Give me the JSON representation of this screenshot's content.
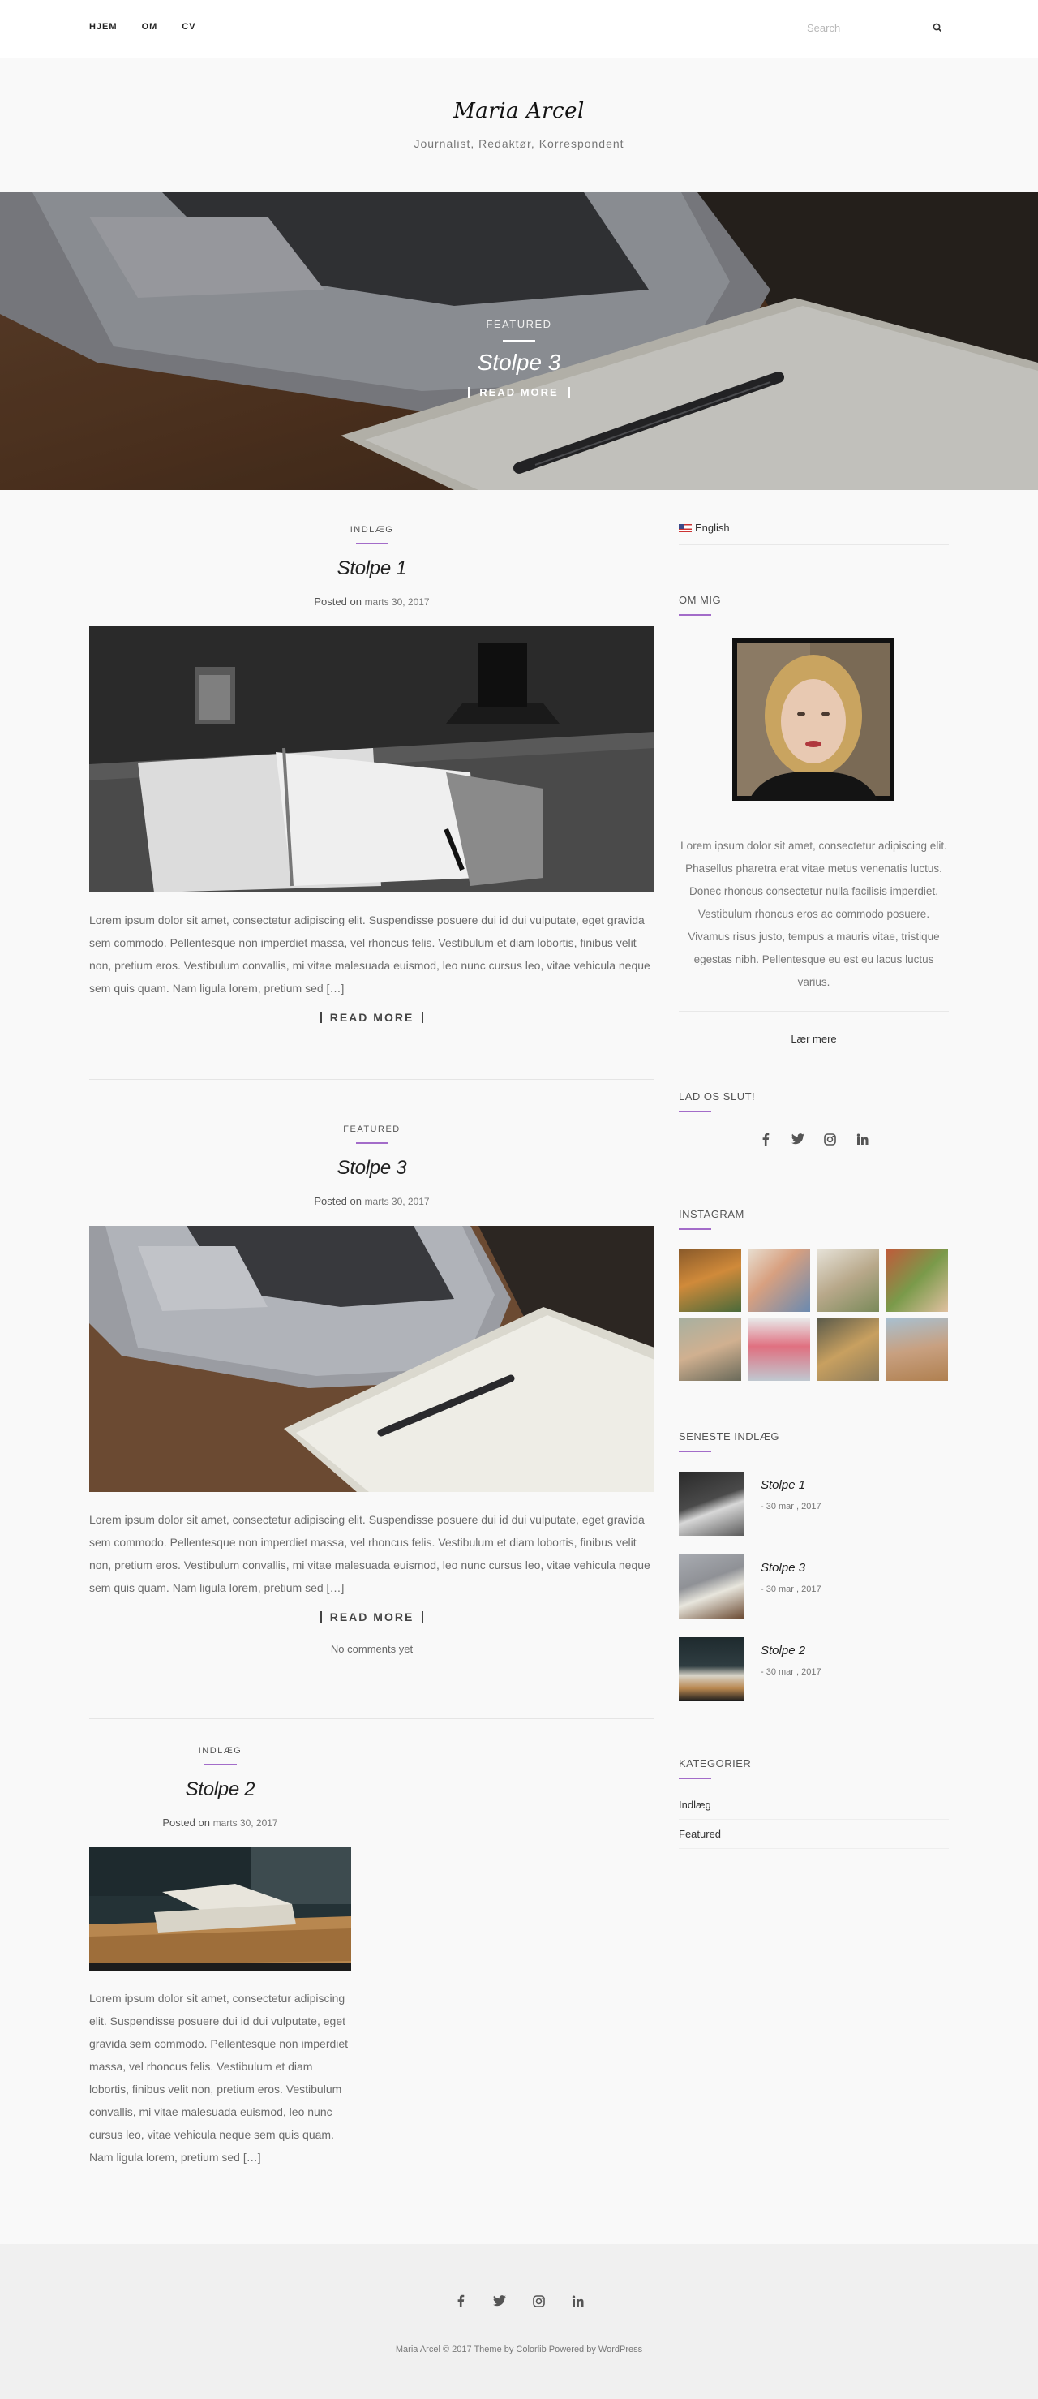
{
  "nav": {
    "items": [
      "HJEM",
      "OM",
      "CV"
    ],
    "search_placeholder": "Search"
  },
  "site": {
    "title": "Maria Arcel",
    "tagline": "Journalist, Redaktør, Korrespondent"
  },
  "hero": {
    "category": "FEATURED",
    "title": "Stolpe 3",
    "read_more": "READ MORE"
  },
  "posts": [
    {
      "category": "INDLÆG",
      "title": "Stolpe 1",
      "posted_on": "Posted on",
      "date": "marts 30, 2017",
      "excerpt": "Lorem ipsum dolor sit amet, consectetur adipiscing elit. Suspendisse posuere dui id dui vulputate, eget gravida sem commodo. Pellentesque non imperdiet massa, vel rhoncus felis. Vestibulum et diam lobortis, finibus velit non, pretium eros. Vestibulum convallis, mi vitae malesuada euismod, leo nunc cursus leo, vitae vehicula neque sem quis quam. Nam ligula lorem, pretium sed […]",
      "read_more": "READ MORE"
    },
    {
      "category": "FEATURED",
      "title": "Stolpe 3",
      "posted_on": "Posted on",
      "date": "marts 30, 2017",
      "excerpt": "Lorem ipsum dolor sit amet, consectetur adipiscing elit. Suspendisse posuere dui id dui vulputate, eget gravida sem commodo. Pellentesque non imperdiet massa, vel rhoncus felis. Vestibulum et diam lobortis, finibus velit non, pretium eros. Vestibulum convallis, mi vitae malesuada euismod, leo nunc cursus leo, vitae vehicula neque sem quis quam. Nam ligula lorem, pretium sed […]",
      "read_more": "READ MORE",
      "comments": "No comments yet"
    },
    {
      "category": "INDLÆG",
      "title": "Stolpe 2",
      "posted_on": "Posted on",
      "date": "marts 30, 2017",
      "excerpt": "Lorem ipsum dolor sit amet, consectetur adipiscing elit. Suspendisse posuere dui id dui vulputate, eget gravida sem commodo. Pellentesque non imperdiet massa, vel rhoncus felis. Vestibulum et diam lobortis, finibus velit non, pretium eros. Vestibulum convallis, mi vitae malesuada euismod, leo nunc cursus leo, vitae vehicula neque sem quis quam. Nam ligula lorem, pretium sed […]"
    }
  ],
  "sidebar": {
    "language": "English",
    "about": {
      "title": "OM MIG",
      "text": "Lorem ipsum dolor sit amet, consectetur adipiscing elit. Phasellus pharetra erat vitae metus venenatis luctus. Donec rhoncus consectetur nulla facilisis imperdiet. Vestibulum rhoncus eros ac commodo posuere. Vivamus risus justo, tempus a mauris vitae, tristique egestas nibh. Pellentesque eu est eu lacus luctus varius.",
      "learn_more": "Lær mere"
    },
    "social": {
      "title": "LAD OS SLUT!",
      "icons": [
        "facebook-icon",
        "twitter-icon",
        "instagram-icon",
        "linkedin-icon"
      ]
    },
    "instagram": {
      "title": "INSTAGRAM"
    },
    "recent": {
      "title": "SENESTE INDLÆG",
      "items": [
        {
          "title": "Stolpe 1",
          "date": "- 30 mar , 2017"
        },
        {
          "title": "Stolpe 3",
          "date": "- 30 mar , 2017"
        },
        {
          "title": "Stolpe 2",
          "date": "- 30 mar , 2017"
        }
      ]
    },
    "categories": {
      "title": "KATEGORIER",
      "items": [
        "Indlæg",
        "Featured"
      ]
    }
  },
  "footer": {
    "copyright": "Maria Arcel © 2017 Theme by Colorlib Powered by WordPress"
  },
  "colors": {
    "accent": "#a36cc9",
    "background": "#f9f9f9",
    "footer": "#f0f0f0"
  }
}
